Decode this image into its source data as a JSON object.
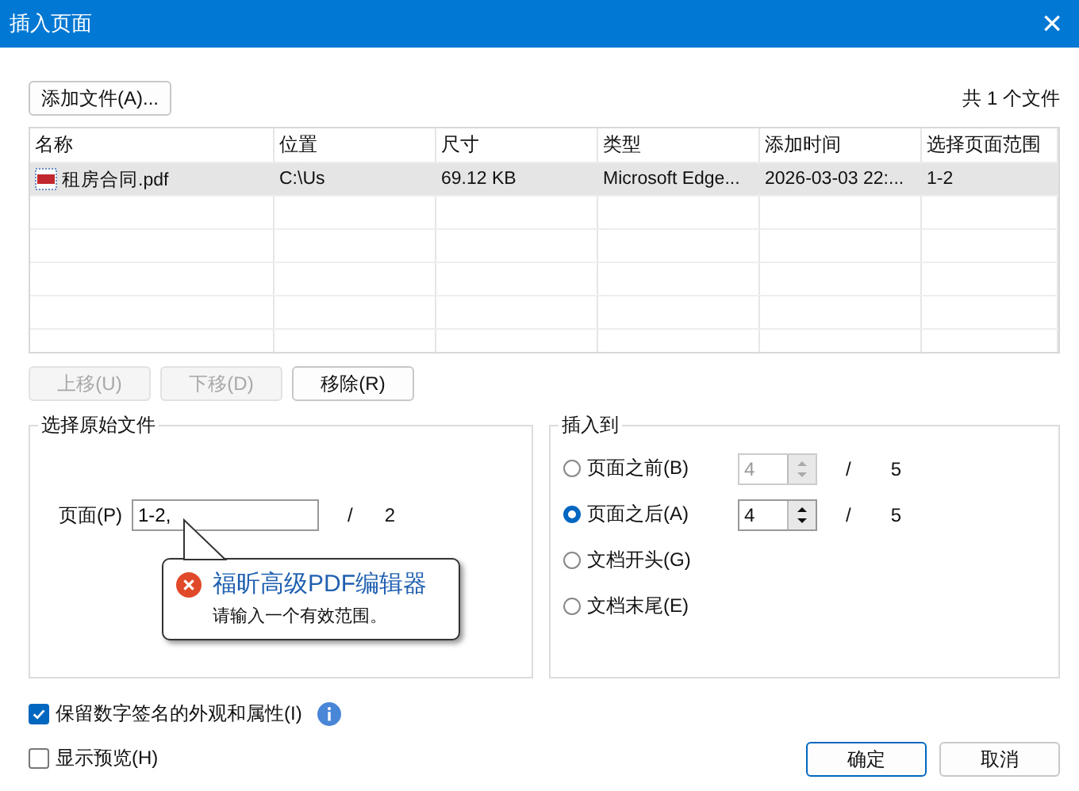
{
  "window": {
    "title": "插入页面",
    "close": "×"
  },
  "add_button": "添加文件(A)...",
  "file_count": "共 1 个文件",
  "table": {
    "columns": [
      "名称",
      "位置",
      "尺寸",
      "类型",
      "添加时间",
      "选择页面范围"
    ],
    "rows": [
      {
        "selected": true,
        "cells": [
          "租房合同.pdf",
          "C:\\Us",
          "69.12 KB",
          "Microsoft Edge...",
          "2026-03-03 22:...",
          "1-2"
        ]
      }
    ]
  },
  "list_buttons": [
    {
      "label": "上移(U)",
      "disabled": true
    },
    {
      "label": "下移(D)",
      "disabled": true
    },
    {
      "label": "移除(R)",
      "disabled": false
    }
  ],
  "source": {
    "title": "选择原始文件",
    "page_label": "页面(P)",
    "page_value": "1-2,",
    "slash": "/",
    "total": "2"
  },
  "tooltip": {
    "title": "福昕高级PDF编辑器",
    "message": "请输入一个有效范围。"
  },
  "insert_to": {
    "title": "插入到",
    "options": [
      {
        "label": "页面之前(B)",
        "selected": false,
        "spinner": {
          "value": "4",
          "disabled": true,
          "slash": "/",
          "total": "5"
        }
      },
      {
        "label": "页面之后(A)",
        "selected": true,
        "spinner": {
          "value": "4",
          "disabled": false,
          "slash": "/",
          "total": "5"
        }
      },
      {
        "label": "文档开头(G)",
        "selected": false
      },
      {
        "label": "文档末尾(E)",
        "selected": false
      }
    ]
  },
  "checkboxes": [
    {
      "label": "保留数字签名的外观和属性(I)",
      "checked": true,
      "info": true
    },
    {
      "label": "显示预览(H)",
      "checked": false
    }
  ],
  "buttons": [
    {
      "label": "确定",
      "default": true
    },
    {
      "label": "取消",
      "default": false
    }
  ]
}
